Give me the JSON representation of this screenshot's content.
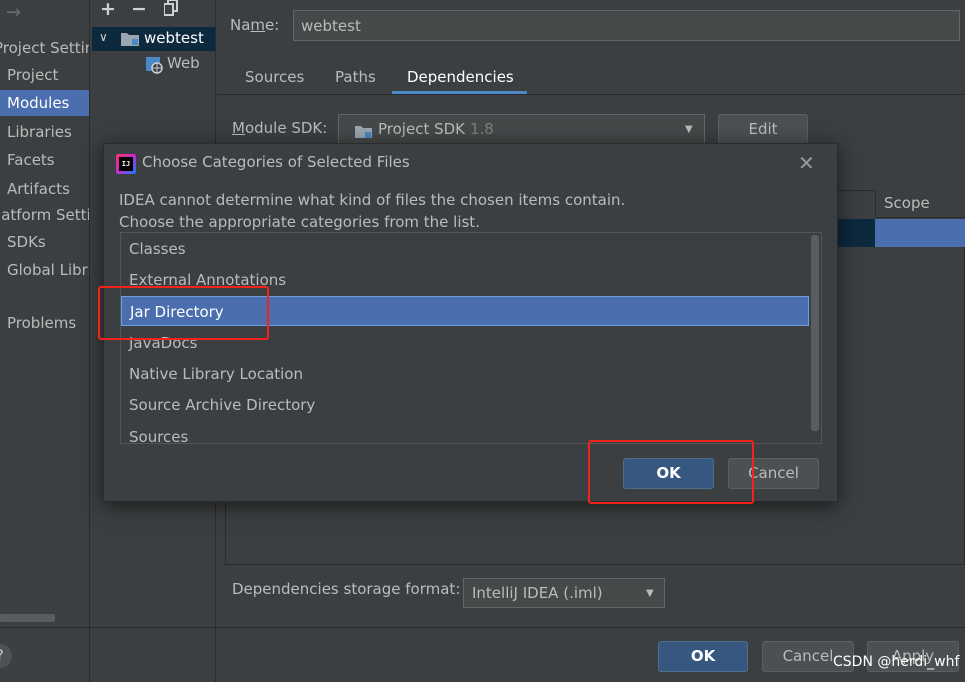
{
  "left_nav": {
    "back_icon": "arrow-left-icon",
    "project_settings_header": "Project Settings",
    "project_items": [
      "Project",
      "Modules",
      "Libraries",
      "Facets",
      "Artifacts"
    ],
    "platform_settings_header": "Platform Settings",
    "platform_items": [
      "SDKs",
      "Global Libraries"
    ],
    "problems": "Problems",
    "selected": "Modules"
  },
  "tree": {
    "toolbar": {
      "add": "+",
      "remove": "−",
      "copy_icon": "copy-icon"
    },
    "module_name": "webtest",
    "facet_name": "Web"
  },
  "module": {
    "name_label": "Name:",
    "name_value": "webtest",
    "tabs": [
      "Sources",
      "Paths",
      "Dependencies"
    ],
    "active_tab": "Dependencies",
    "sdk_label": "Module SDK:",
    "sdk_value": "Project SDK",
    "sdk_version": "1.8",
    "edit_button": "Edit",
    "scope_header": "Scope",
    "storage_label": "Dependencies storage format:",
    "storage_value": "IntelliJ IDEA (.iml)"
  },
  "footer": {
    "ok": "OK",
    "cancel": "Cancel",
    "apply": "Apply"
  },
  "dialog": {
    "logo_text": "IJ",
    "title": "Choose Categories of Selected Files",
    "message_line1": "IDEA cannot determine what kind of files the chosen items contain.",
    "message_line2": "Choose the appropriate categories from the list.",
    "categories": [
      "Classes",
      "External Annotations",
      "Jar Directory",
      "JavaDocs",
      "Native Library Location",
      "Source Archive Directory",
      "Sources"
    ],
    "selected_category": "Jar Directory",
    "ok": "OK",
    "cancel": "Cancel"
  },
  "watermark": "CSDN @herdi_whf",
  "colors": {
    "background": "#3c3f41",
    "selection": "#4b6eaf",
    "primary_button": "#365880",
    "highlight_box": "#f5231c"
  }
}
